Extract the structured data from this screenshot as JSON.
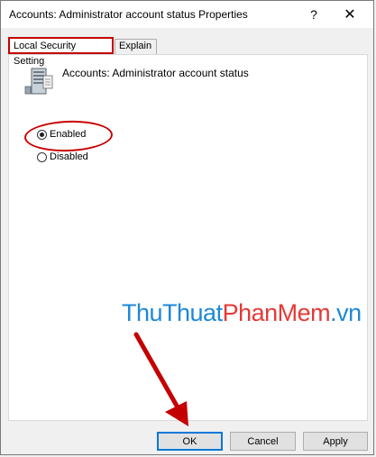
{
  "window": {
    "title": "Accounts: Administrator account status Properties",
    "help_glyph": "?",
    "close_glyph": "✕"
  },
  "tabs": [
    {
      "label": "Local Security Setting",
      "active": true
    },
    {
      "label": "Explain",
      "active": false
    }
  ],
  "policy": {
    "icon": "server-policy-icon",
    "name": "Accounts: Administrator account status"
  },
  "options": [
    {
      "label": "Enabled",
      "checked": true
    },
    {
      "label": "Disabled",
      "checked": false
    }
  ],
  "watermark": {
    "part1": "ThuThuat",
    "part2": "PhanMem",
    "part3": ".vn"
  },
  "buttons": {
    "ok": "OK",
    "cancel": "Cancel",
    "apply": "Apply"
  },
  "colors": {
    "highlight": "#c40000",
    "watermark_blue": "#1e88d8",
    "watermark_red": "#e53935",
    "focus": "#0078d7"
  }
}
